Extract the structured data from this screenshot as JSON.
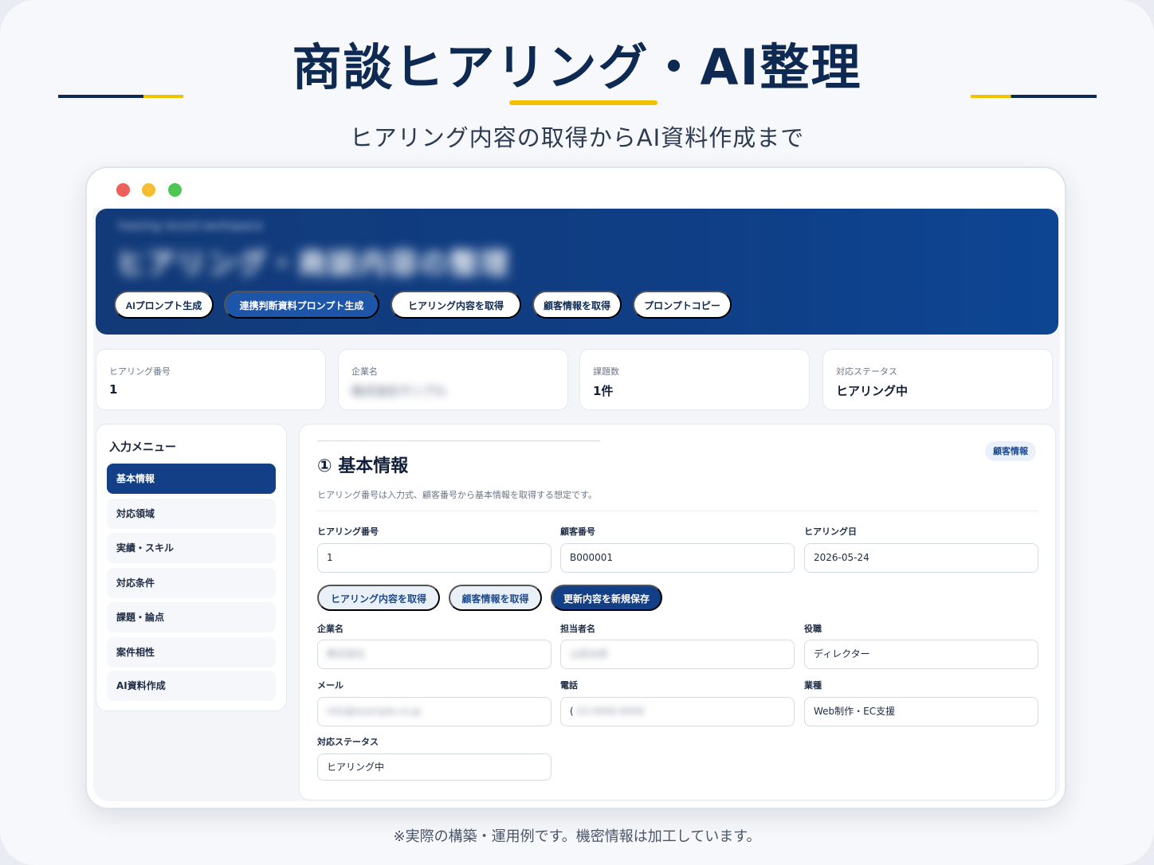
{
  "hero": {
    "title": "商談ヒアリング・AI整理",
    "subtitle": "ヒアリング内容の取得からAI資料作成まで"
  },
  "banner": {
    "small_text": "hearing record workspace",
    "title": "ヒアリング・商談内容の整理",
    "buttons": [
      "AIプロンプト生成",
      "連携判断資料プロンプト生成",
      "ヒアリング内容を取得",
      "顧客情報を取得",
      "プロンプトコピー"
    ]
  },
  "stats": [
    {
      "label": "ヒアリング番号",
      "value": "1"
    },
    {
      "label": "企業名",
      "value": "株式会社サンプル"
    },
    {
      "label": "課題数",
      "value": "1件"
    },
    {
      "label": "対応ステータス",
      "value": "ヒアリング中"
    }
  ],
  "sidebar": {
    "title": "入力メニュー",
    "items": [
      "基本情報",
      "対応領域",
      "実績・スキル",
      "対応条件",
      "課題・論点",
      "案件相性",
      "AI資料作成"
    ]
  },
  "section": {
    "title": "① 基本情報",
    "badge": "顧客情報",
    "description": "ヒアリング番号は入力式、顧客番号から基本情報を取得する想定です。"
  },
  "fields": {
    "hearing_no": {
      "label": "ヒアリング番号",
      "value": "1"
    },
    "customer_no": {
      "label": "顧客番号",
      "value": "B000001"
    },
    "hearing_date": {
      "label": "ヒアリング日",
      "value": "2026-05-24"
    },
    "company": {
      "label": "企業名",
      "value": "株式会社"
    },
    "contact": {
      "label": "担当者名",
      "value": "山田太郎"
    },
    "role": {
      "label": "役職",
      "value": "ディレクター"
    },
    "email": {
      "label": "メール",
      "value": "info@example.co.jp"
    },
    "phone_prefix": "(",
    "phone": {
      "label": "電話",
      "value": "03-0000-0000"
    },
    "industry": {
      "label": "業種",
      "value": "Web制作・EC支援"
    },
    "status": {
      "label": "対応ステータス",
      "value": "ヒアリング中"
    }
  },
  "actions": {
    "fetch_hearing": "ヒアリング内容を取得",
    "fetch_customer": "顧客情報を取得",
    "save_new": "更新内容を新規保存"
  },
  "footnote": "※実際の構築・運用例です。機密情報は加工しています。"
}
